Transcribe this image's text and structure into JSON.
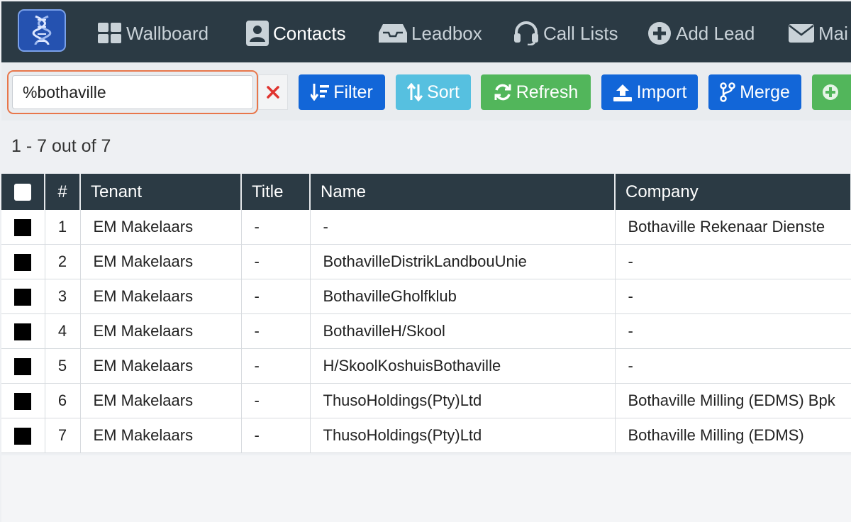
{
  "nav": {
    "items": [
      {
        "label": "Wallboard",
        "icon": "grid-icon"
      },
      {
        "label": "Contacts",
        "icon": "contact-card-icon",
        "active": true
      },
      {
        "label": "Leadbox",
        "icon": "inbox-icon"
      },
      {
        "label": "Call Lists",
        "icon": "headset-icon"
      },
      {
        "label": "Add Lead",
        "icon": "plus-circle-icon"
      },
      {
        "label": "Mai",
        "icon": "envelope-icon"
      }
    ]
  },
  "toolbar": {
    "search": {
      "value": "%bothaville"
    },
    "buttons": {
      "filter": "Filter",
      "sort": "Sort",
      "refresh": "Refresh",
      "import": "Import",
      "merge": "Merge",
      "add": ""
    },
    "colors": {
      "primary": "#1266d8",
      "info": "#56c0e0",
      "success": "#52b65b",
      "danger": "#e0342f",
      "highlight": "#e8764a"
    }
  },
  "results": {
    "count_text": "1 - 7 out of 7"
  },
  "table": {
    "headers": [
      "#",
      "Tenant",
      "Title",
      "Name",
      "Company"
    ],
    "rows": [
      {
        "num": "1",
        "tenant": "EM Makelaars",
        "title": "-",
        "name": "-",
        "company": "Bothaville Rekenaar Dienste"
      },
      {
        "num": "2",
        "tenant": "EM Makelaars",
        "title": "-",
        "name": "BothavilleDistrikLandbouUnie",
        "company": "-"
      },
      {
        "num": "3",
        "tenant": "EM Makelaars",
        "title": "-",
        "name": "BothavilleGholfklub",
        "company": "-"
      },
      {
        "num": "4",
        "tenant": "EM Makelaars",
        "title": "-",
        "name": "BothavilleH/Skool",
        "company": "-"
      },
      {
        "num": "5",
        "tenant": "EM Makelaars",
        "title": "-",
        "name": "H/SkoolKoshuisBothaville",
        "company": "-"
      },
      {
        "num": "6",
        "tenant": "EM Makelaars",
        "title": "-",
        "name": "ThusoHoldings(Pty)Ltd",
        "company": "Bothaville Milling (EDMS) Bpk"
      },
      {
        "num": "7",
        "tenant": "EM Makelaars",
        "title": "-",
        "name": "ThusoHoldings(Pty)Ltd",
        "company": "Bothaville Milling (EDMS)"
      }
    ]
  }
}
